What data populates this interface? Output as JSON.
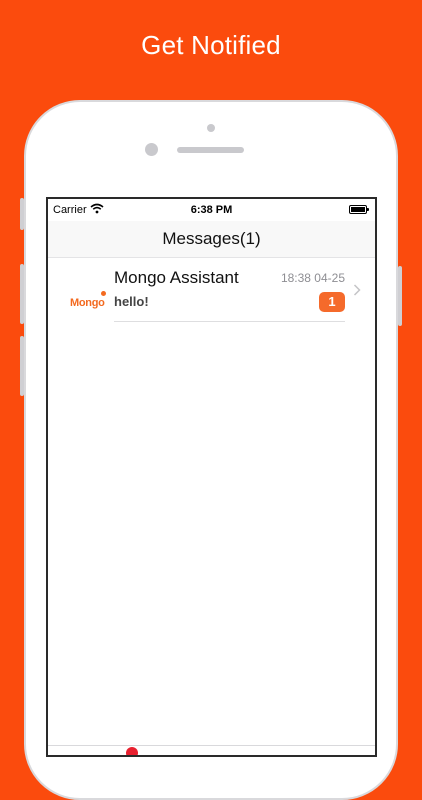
{
  "headline": "Get Notified",
  "status_bar": {
    "carrier": "Carrier",
    "time": "6:38 PM",
    "wifi_icon": "wifi-icon",
    "battery_icon": "battery-icon"
  },
  "nav": {
    "title": "Messages(1)"
  },
  "messages": [
    {
      "avatar_text": "Mongo",
      "sender": "Mongo Assistant",
      "timestamp": "18:38 04-25",
      "preview": "hello!",
      "unread_count": "1"
    }
  ],
  "colors": {
    "background": "#fb4b0d",
    "accent": "#f56a2b",
    "tab_dot": "#e8202f"
  }
}
